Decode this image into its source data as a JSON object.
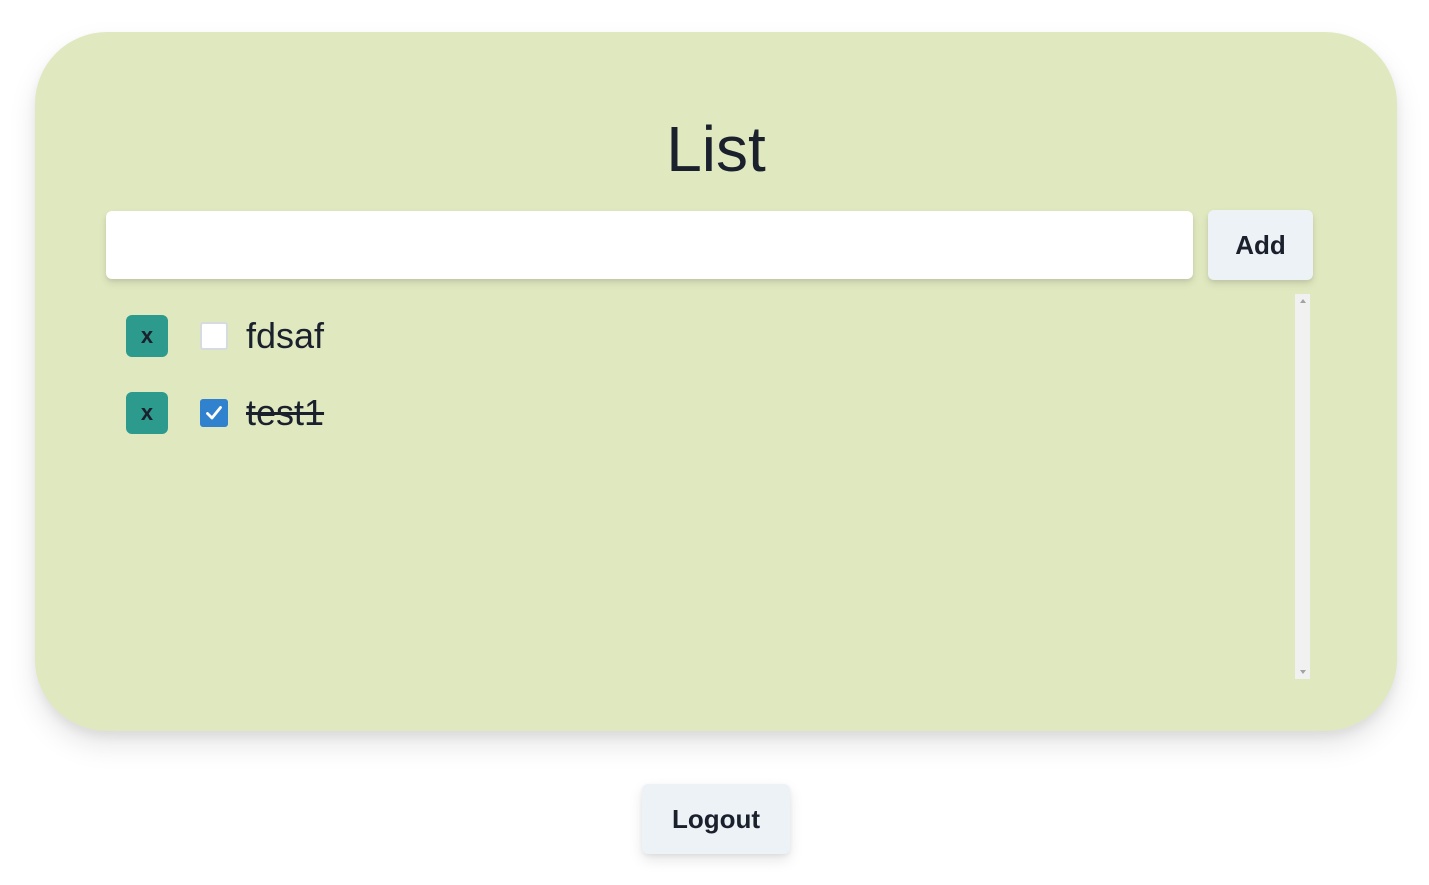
{
  "page": {
    "title": "List"
  },
  "new_item": {
    "value": "",
    "placeholder": "",
    "add_label": "Add"
  },
  "items": [
    {
      "delete_label": "x",
      "checked": false,
      "text": "fdsaf"
    },
    {
      "delete_label": "x",
      "checked": true,
      "text": "test1"
    }
  ],
  "footer": {
    "logout_label": "Logout"
  },
  "colors": {
    "card_background": "#e0e8c0",
    "delete_button": "#2c9a8c",
    "checkbox_checked": "#3182ce",
    "button_background": "#edf2f7",
    "text": "#1a202c"
  },
  "icons": {
    "checkmark": "check-icon",
    "scroll_up": "scroll-up-arrow-icon",
    "scroll_down": "scroll-down-arrow-icon"
  }
}
